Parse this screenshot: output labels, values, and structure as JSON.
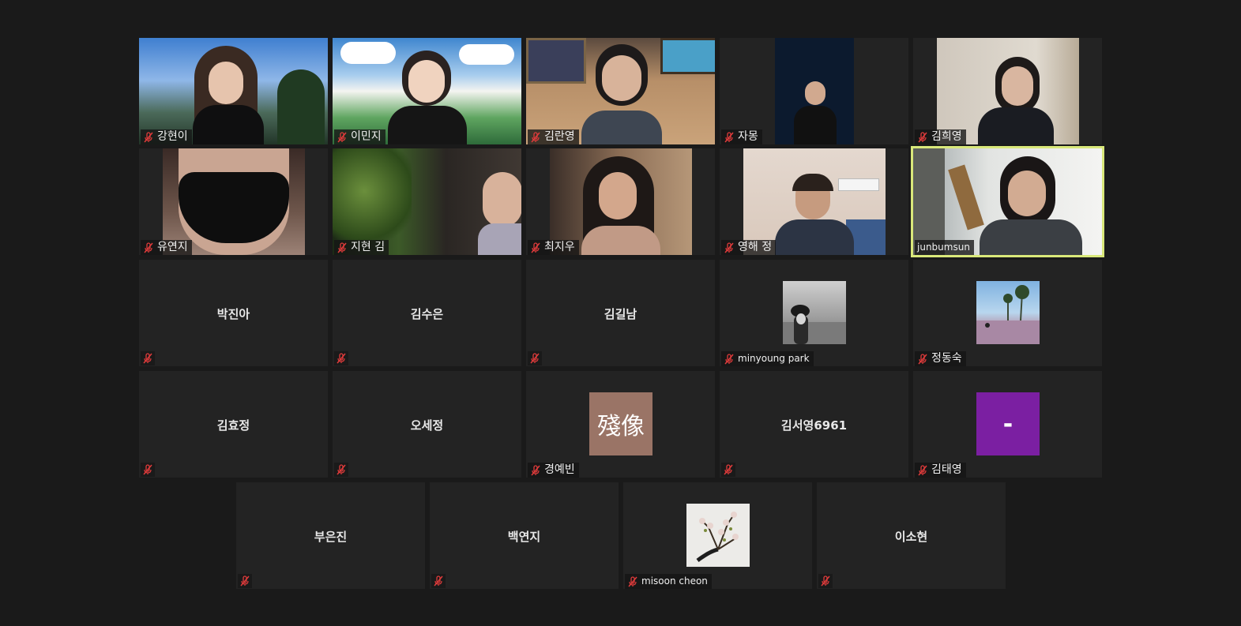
{
  "gallery": {
    "row1": [
      {
        "name": "강현이",
        "muted": true,
        "video": true
      },
      {
        "name": "이민지",
        "muted": true,
        "video": true
      },
      {
        "name": "김란영",
        "muted": true,
        "video": true
      },
      {
        "name": "자몽",
        "muted": true,
        "video": true
      },
      {
        "name": "김희영",
        "muted": true,
        "video": true
      }
    ],
    "row2": [
      {
        "name": "유연지",
        "muted": true,
        "video": true
      },
      {
        "name": "지현 김",
        "muted": true,
        "video": true
      },
      {
        "name": "최지우",
        "muted": true,
        "video": true
      },
      {
        "name": "영해 정",
        "muted": true,
        "video": true
      },
      {
        "name": "junbumsun",
        "muted": false,
        "video": true,
        "active_speaker": true
      }
    ],
    "row3": [
      {
        "name": "박진아",
        "muted": true,
        "video": false
      },
      {
        "name": "김수은",
        "muted": true,
        "video": false
      },
      {
        "name": "김길남",
        "muted": true,
        "video": false
      },
      {
        "name": "minyoung park",
        "muted": true,
        "video": false,
        "avatar": "photo-portrait-icon"
      },
      {
        "name": "정동숙",
        "muted": true,
        "video": false,
        "avatar": "photo-landscape-icon"
      }
    ],
    "row4": [
      {
        "name": "김효정",
        "muted": true,
        "video": false
      },
      {
        "name": "오세정",
        "muted": true,
        "video": false
      },
      {
        "name": "경예빈",
        "muted": true,
        "video": false,
        "avatar_text": "殘像",
        "avatar_color": "#9a7466"
      },
      {
        "name": "김서영6961",
        "muted": true,
        "video": false
      },
      {
        "name": "김태영",
        "muted": true,
        "video": false,
        "avatar_text": "-",
        "avatar_color": "#7b1fa2"
      }
    ],
    "row5": [
      {
        "name": "부은진",
        "muted": true,
        "video": false
      },
      {
        "name": "백연지",
        "muted": true,
        "video": false
      },
      {
        "name": "misoon cheon",
        "muted": true,
        "video": false,
        "avatar": "photo-embroidery-icon"
      },
      {
        "name": "이소현",
        "muted": true,
        "video": false
      }
    ]
  },
  "colors": {
    "background": "#1a1a1a",
    "tile": "#232323",
    "active_speaker_border": "#d9e87a",
    "mute_icon": "#e03b3b"
  }
}
